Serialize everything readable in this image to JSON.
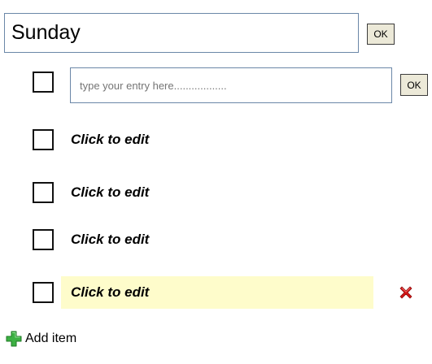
{
  "list": {
    "title_value": "Sunday",
    "title_ok_label": "OK"
  },
  "new_entry": {
    "placeholder": "type your entry here..................",
    "ok_label": "OK"
  },
  "items": [
    {
      "label": "Click to edit",
      "checked": false,
      "highlighted": false
    },
    {
      "label": "Click to edit",
      "checked": false,
      "highlighted": false
    },
    {
      "label": "Click to edit",
      "checked": false,
      "highlighted": false
    },
    {
      "label": "Click to edit",
      "checked": false,
      "highlighted": true
    }
  ],
  "footer": {
    "add_label": "Add item"
  },
  "colors": {
    "highlight": "#fefccb",
    "button_face": "#ece9d8",
    "input_border": "#6b87a8",
    "delete_red": "#d41616",
    "add_green": "#3cb043"
  },
  "icons": {
    "delete": "delete-x-icon",
    "add": "plus-icon"
  }
}
